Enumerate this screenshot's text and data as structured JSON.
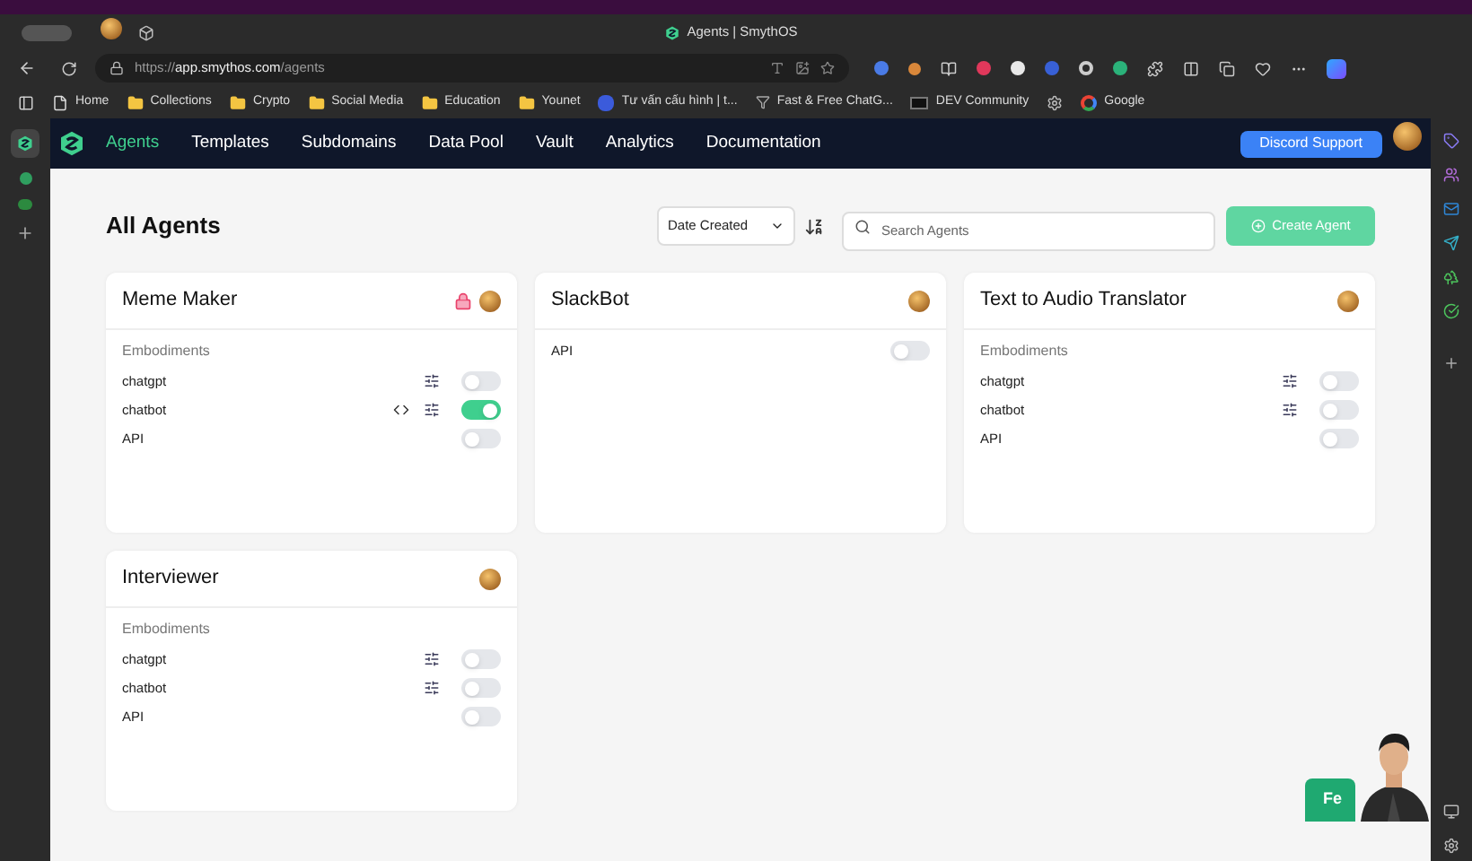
{
  "browser": {
    "tab_title": "Agents | SmythOS",
    "url_scheme": "https://",
    "url_host": "app.smythos.com",
    "url_path": "/agents",
    "bookmarks": [
      {
        "kind": "page",
        "label": "Home"
      },
      {
        "kind": "folder",
        "label": "Collections"
      },
      {
        "kind": "folder",
        "label": "Crypto"
      },
      {
        "kind": "folder",
        "label": "Social Media"
      },
      {
        "kind": "folder",
        "label": "Education"
      },
      {
        "kind": "folder",
        "label": "Younet"
      },
      {
        "kind": "site",
        "label": "Tư vấn cấu hình | t..."
      },
      {
        "kind": "filter",
        "label": "Fast & Free ChatG..."
      },
      {
        "kind": "dev",
        "label": "DEV Community"
      },
      {
        "kind": "gear"
      },
      {
        "kind": "google",
        "label": "Google"
      }
    ]
  },
  "nav": {
    "items": [
      {
        "label": "Agents",
        "selected": true
      },
      {
        "label": "Templates",
        "selected": false
      },
      {
        "label": "Subdomains",
        "selected": false
      },
      {
        "label": "Data Pool",
        "selected": false
      },
      {
        "label": "Vault",
        "selected": false
      },
      {
        "label": "Analytics",
        "selected": false
      },
      {
        "label": "Documentation",
        "selected": false
      }
    ],
    "support_button": "Discord Support"
  },
  "page": {
    "title": "All Agents",
    "sort": "Date Created",
    "search": {
      "placeholder": "Search Agents"
    },
    "create_button": "Create Agent"
  },
  "agents": [
    {
      "name": "Meme Maker",
      "locked": true,
      "embodiments_label": "Embodiments",
      "embodiments": [
        {
          "name": "chatgpt",
          "code": false,
          "settings": true,
          "on": false
        },
        {
          "name": "chatbot",
          "code": true,
          "settings": true,
          "on": true
        },
        {
          "name": "API",
          "code": false,
          "settings": false,
          "on": false
        }
      ]
    },
    {
      "name": "SlackBot",
      "locked": false,
      "embodiments": [
        {
          "name": "API",
          "code": false,
          "settings": false,
          "on": false
        }
      ]
    },
    {
      "name": "Text to Audio Translator",
      "locked": false,
      "embodiments_label": "Embodiments",
      "embodiments": [
        {
          "name": "chatgpt",
          "code": false,
          "settings": true,
          "on": false
        },
        {
          "name": "chatbot",
          "code": false,
          "settings": true,
          "on": false
        },
        {
          "name": "API",
          "code": false,
          "settings": false,
          "on": false
        }
      ]
    },
    {
      "name": "Interviewer",
      "locked": false,
      "embodiments_label": "Embodiments",
      "embodiments": [
        {
          "name": "chatgpt",
          "code": false,
          "settings": true,
          "on": false
        },
        {
          "name": "chatbot",
          "code": false,
          "settings": true,
          "on": false
        },
        {
          "name": "API",
          "code": false,
          "settings": false,
          "on": false
        }
      ]
    }
  ],
  "feedback_button": "Fe"
}
